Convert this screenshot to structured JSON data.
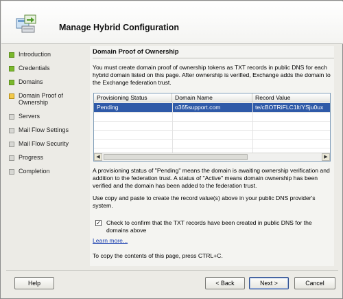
{
  "header": {
    "title": "Manage Hybrid Configuration",
    "icon": "exchange-hybrid-icon"
  },
  "nav": {
    "items": [
      {
        "label": "Introduction",
        "state": "done"
      },
      {
        "label": "Credentials",
        "state": "done"
      },
      {
        "label": "Domains",
        "state": "done"
      },
      {
        "label": "Domain Proof of Ownership",
        "state": "current"
      },
      {
        "label": "Servers",
        "state": "pending"
      },
      {
        "label": "Mail Flow Settings",
        "state": "pending"
      },
      {
        "label": "Mail Flow Security",
        "state": "pending"
      },
      {
        "label": "Progress",
        "state": "pending"
      },
      {
        "label": "Completion",
        "state": "pending"
      }
    ]
  },
  "main": {
    "title": "Domain Proof of Ownership",
    "intro": "You must create domain proof of ownership tokens as TXT records in public DNS for each hybrid domain listed on this page. After ownership is verified, Exchange adds the domain to the Exchange federation trust.",
    "table": {
      "columns": [
        "Provisioning Status",
        "Domain Name",
        "Record Value"
      ],
      "rows": [
        [
          "Pending",
          "o365support.com",
          "te/cBOTRiFLC1lt/YSju0ux"
        ]
      ]
    },
    "status_note": "A provisioning status of \"Pending\" means the domain is awaiting ownership verification and addition to the federation trust. A status of \"Active\" means domain ownership has been verified and the domain has been added to the federation trust.",
    "copy_note": "Use copy and paste to create the record value(s) above in your public DNS provider's system.",
    "confirm_checkbox": {
      "checked": true,
      "label": "Check to confirm that the TXT records have been created in public DNS for the domains above"
    },
    "learn_more": "Learn more...",
    "copy_hint": "To copy the contents of this page, press CTRL+C."
  },
  "footer": {
    "help": "Help",
    "back": "< Back",
    "next": "Next >",
    "cancel": "Cancel"
  },
  "colors": {
    "done": "#7ab82c",
    "current": "#f2c94a",
    "pending": "#d7d7d3",
    "selection": "#2f5aa8",
    "link": "#1a3fb0"
  }
}
